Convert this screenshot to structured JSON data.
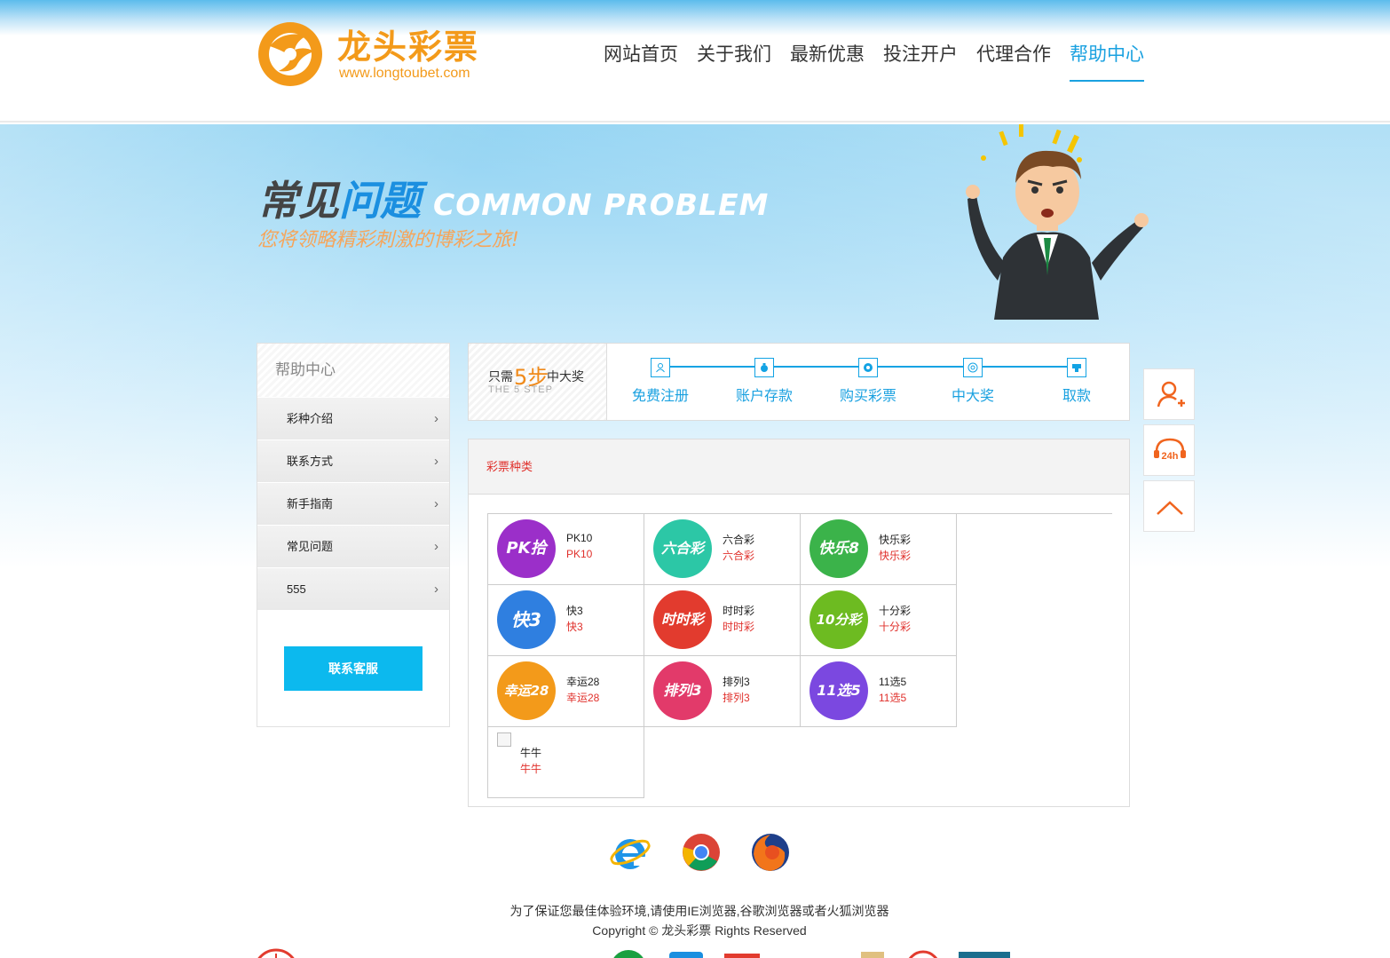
{
  "brand": {
    "name": "龙头彩票",
    "url": "www.longtoubet.com",
    "color": "#f39a1a"
  },
  "nav": [
    {
      "label": "网站首页",
      "active": false
    },
    {
      "label": "关于我们",
      "active": false
    },
    {
      "label": "最新优惠",
      "active": false
    },
    {
      "label": "投注开户",
      "active": false
    },
    {
      "label": "代理合作",
      "active": false
    },
    {
      "label": "帮助中心",
      "active": true
    }
  ],
  "banner": {
    "title_dark": "常见",
    "title_blue": "问题",
    "title_en": "COMMON PROBLEM",
    "subtitle": "您将领略精彩刺激的博彩之旅!"
  },
  "sidebar": {
    "title": "帮助中心",
    "items": [
      {
        "label": "彩种介绍",
        "arrow": "›"
      },
      {
        "label": "联系方式",
        "arrow": "›"
      },
      {
        "label": "新手指南",
        "arrow": "›"
      },
      {
        "label": "常见问题",
        "arrow": "›"
      },
      {
        "label": "555",
        "arrow": "›"
      }
    ],
    "contact_button": "联系客服"
  },
  "steps": {
    "badge_pre": "只需",
    "badge_num": "5步",
    "badge_post": "中大奖",
    "badge_en": "THE 5 STEP",
    "items": [
      {
        "label": "免费注册",
        "icon": "user-icon"
      },
      {
        "label": "账户存款",
        "icon": "money-bag-icon"
      },
      {
        "label": "购买彩票",
        "icon": "lottery-ball-icon"
      },
      {
        "label": "中大奖",
        "icon": "prize-icon"
      },
      {
        "label": "取款",
        "icon": "withdraw-icon"
      }
    ]
  },
  "content": {
    "heading": "彩票种类",
    "lotteries": [
      {
        "name": "PK10",
        "sub": "PK10",
        "logo_text": "PK拾",
        "color": "#9b2fc9"
      },
      {
        "name": "六合彩",
        "sub": "六合彩",
        "logo_text": "六合彩",
        "color": "#2cc7a6"
      },
      {
        "name": "快乐彩",
        "sub": "快乐彩",
        "logo_text": "快乐8",
        "color": "#3bb34a"
      },
      {
        "name": "快3",
        "sub": "快3",
        "logo_text": "快3",
        "color": "#2f7fe0"
      },
      {
        "name": "时时彩",
        "sub": "时时彩",
        "logo_text": "时时彩",
        "color": "#e23b2e"
      },
      {
        "name": "十分彩",
        "sub": "十分彩",
        "logo_text": "10分彩",
        "color": "#6dbb21"
      },
      {
        "name": "幸运28",
        "sub": "幸运28",
        "logo_text": "幸运28",
        "color": "#f39a1a"
      },
      {
        "name": "排列3",
        "sub": "排列3",
        "logo_text": "排列3",
        "color": "#e23a6a"
      },
      {
        "name": "11选5",
        "sub": "11选5",
        "logo_text": "11选5",
        "color": "#7b48e0"
      },
      {
        "name": "牛牛",
        "sub": "牛牛",
        "logo_text": "",
        "color": ""
      }
    ]
  },
  "footer": {
    "browser_note": "为了保证您最佳体验环境,请使用IE浏览器,谷歌浏览器或者火狐浏览器",
    "copyright": "Copyright © 龙头彩票 Rights Reserved",
    "browsers": [
      "ie-icon",
      "chrome-icon",
      "firefox-icon"
    ]
  },
  "colors": {
    "accent_blue": "#1aa1e0",
    "red": "#e0302b",
    "contact_btn": "#0cb9ee"
  }
}
